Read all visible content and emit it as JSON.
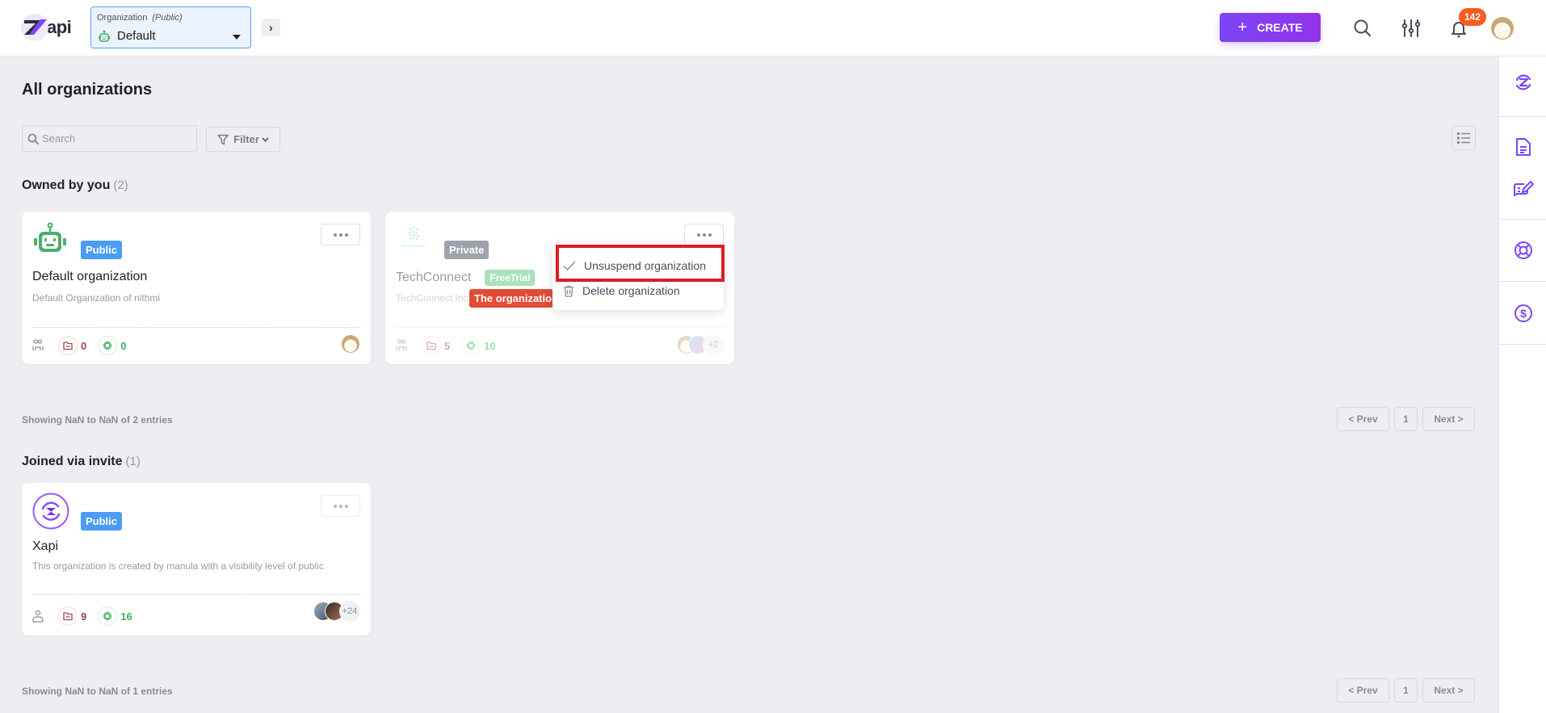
{
  "header": {
    "logo_text": "api",
    "org_selector": {
      "label": "Organization",
      "visibility": "(Public)",
      "value": "Default"
    },
    "create_label": "CREATE",
    "notification_count": "142"
  },
  "page": {
    "title": "All organizations",
    "search_placeholder": "Search",
    "filter_label": "Filter"
  },
  "owned": {
    "title": "Owned by you",
    "count": "(2)",
    "cards": [
      {
        "name": "Default organization",
        "visibility": "Public",
        "description": "Default Organization of nithmi",
        "folders": "0",
        "chips": "0"
      },
      {
        "name": "TechConnect",
        "visibility": "Private",
        "plan": "FreeTrial",
        "description": "TechConnect Inc",
        "suspend_notice": "The organization is suspended",
        "folders": "5",
        "chips": "10",
        "extra_members": "+2"
      }
    ],
    "showing": "Showing NaN to NaN of 2 entries"
  },
  "dropdown": {
    "items": [
      {
        "label": "Unsuspend organization",
        "icon": "check-icon"
      },
      {
        "label": "Delete organization",
        "icon": "trash-icon"
      }
    ]
  },
  "joined": {
    "title": "Joined via invite",
    "count": "(1)",
    "cards": [
      {
        "name": "Xapi",
        "visibility": "Public",
        "description": "This organization is created by manula with a visibility level of public",
        "folders": "9",
        "chips": "16",
        "extra_members": "+24"
      }
    ],
    "showing": "Showing NaN to NaN of 1 entries"
  },
  "pagination": {
    "prev": "< Prev",
    "page": "1",
    "next": "Next >"
  },
  "colors": {
    "accent": "#7b45f5",
    "public_badge": "#4a9cf5",
    "private_badge": "#6b6f80",
    "suspended": "#e24c36",
    "notification": "#fc5a1f"
  }
}
